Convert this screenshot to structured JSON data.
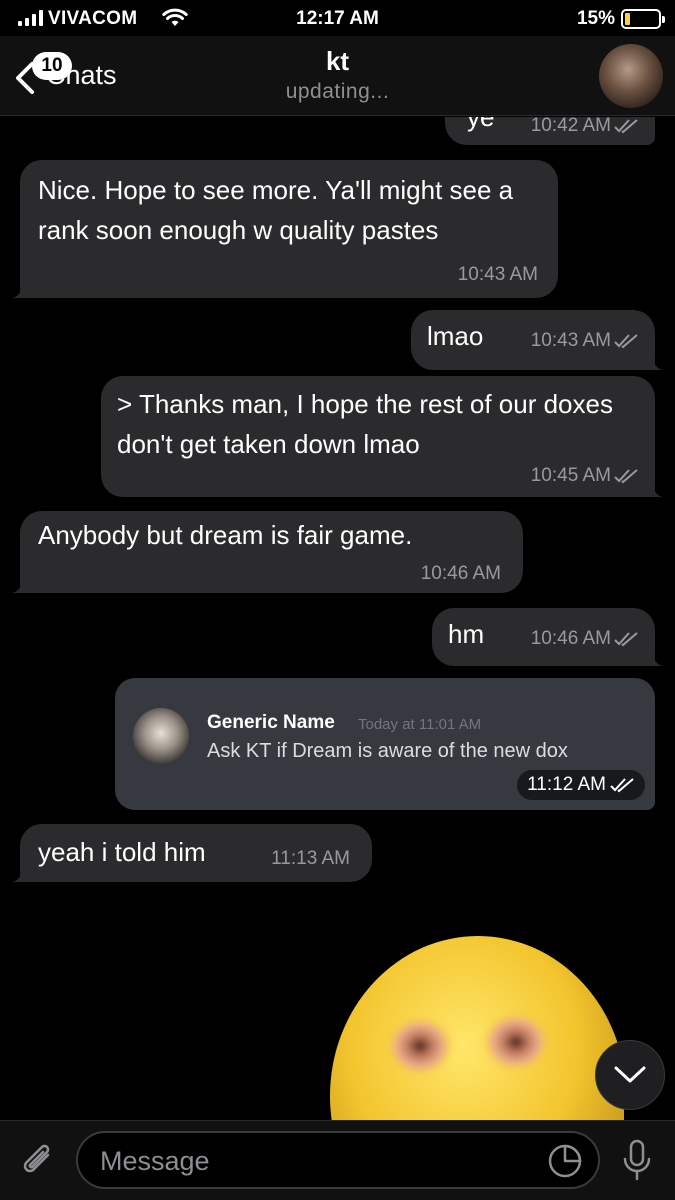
{
  "status_bar": {
    "carrier": "VIVACOM",
    "time": "12:17 AM",
    "battery_percent": "15%",
    "battery_level": 0.15
  },
  "header": {
    "back_label": "Chats",
    "unread_badge": "10",
    "title": "kt",
    "subtitle": "updating..."
  },
  "messages": [
    {
      "direction": "out",
      "text": "ye",
      "time": "10:42 AM",
      "read": true
    },
    {
      "direction": "in",
      "text": "Nice. Hope to see more. Ya'll might see a rank soon enough w quality pastes",
      "time": "10:43 AM"
    },
    {
      "direction": "out",
      "text": "lmao",
      "time": "10:43 AM",
      "read": true
    },
    {
      "direction": "out",
      "text": "> Thanks man, I hope the rest of our doxes don't get taken down lmao",
      "time": "10:45 AM",
      "read": true
    },
    {
      "direction": "in",
      "text": "Anybody but dream is fair game.",
      "time": "10:46 AM"
    },
    {
      "direction": "out",
      "text": "hm",
      "time": "10:46 AM",
      "read": true
    },
    {
      "direction": "out",
      "type": "image",
      "time": "11:12 AM",
      "read": true,
      "embedded": {
        "author": "Generic Name",
        "timestamp": "Today at 11:01 AM",
        "text": "Ask KT if Dream is aware of the new dox"
      }
    },
    {
      "direction": "in",
      "text": "yeah i told him",
      "time": "11:13 AM"
    }
  ],
  "input": {
    "placeholder": "Message"
  },
  "icons": {
    "back": "chevron-left-icon",
    "attach": "paperclip-icon",
    "sticker": "sticker-icon",
    "mic": "microphone-icon",
    "scroll": "chevron-down-icon",
    "read": "double-check-icon"
  },
  "colors": {
    "bubble": "#2b2b2d",
    "background": "#000000",
    "header": "#111111",
    "battery": "#f5d33b"
  }
}
